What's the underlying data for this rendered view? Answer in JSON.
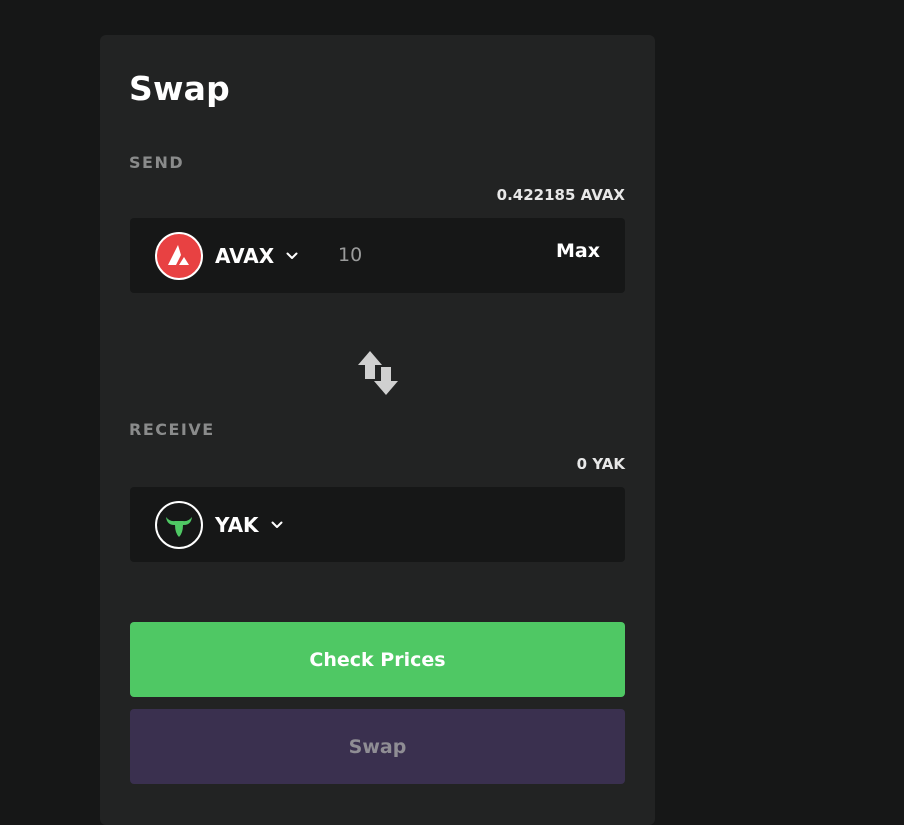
{
  "swap": {
    "title": "Swap",
    "send": {
      "label": "SEND",
      "balance": "0.422185 AVAX",
      "token": {
        "symbol": "AVAX",
        "logo_icon": "avalanche-logo-icon",
        "logo_color": "#e84142"
      },
      "amount": "10",
      "max_label": "Max"
    },
    "switch_icon": "swap-direction-arrows-icon",
    "receive": {
      "label": "RECEIVE",
      "balance": "0 YAK",
      "token": {
        "symbol": "YAK",
        "logo_icon": "yak-bull-logo-icon",
        "logo_color": "#4fc864"
      }
    },
    "buttons": {
      "check_prices": "Check Prices",
      "swap": "Swap"
    }
  },
  "colors": {
    "background": "#161717",
    "panel": "#222323",
    "accent_green": "#4fc864",
    "disabled_purple": "#3a304f"
  }
}
